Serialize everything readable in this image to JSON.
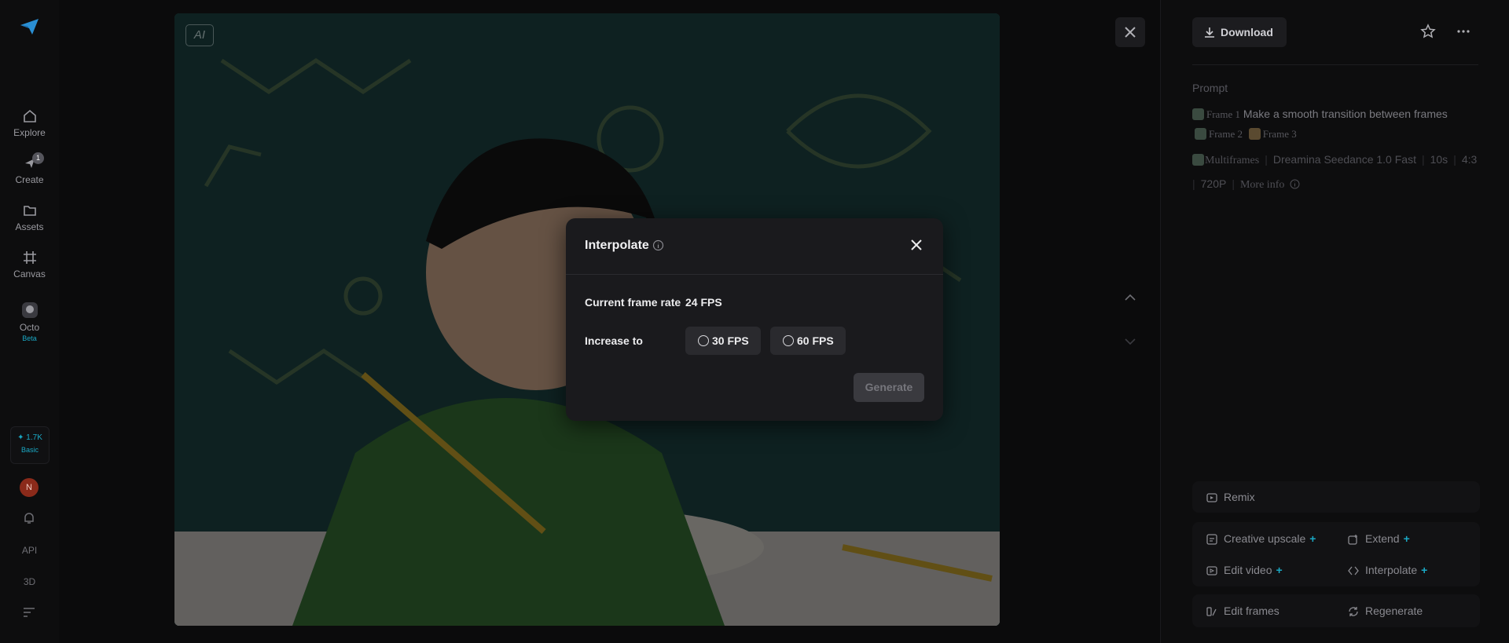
{
  "nav": {
    "items": [
      {
        "label": "Explore"
      },
      {
        "label": "Create",
        "badge": "1"
      },
      {
        "label": "Assets"
      },
      {
        "label": "Canvas"
      },
      {
        "label": "Octo",
        "tag": "Beta"
      }
    ],
    "credits": {
      "amount": "1.7K",
      "tier": "Basic"
    },
    "avatar_initial": "N",
    "api_label": "API",
    "three_d_label": "3D"
  },
  "image": {
    "ai_tag": "AI"
  },
  "panel": {
    "download_label": "Download",
    "prompt_label": "Prompt",
    "frame1": "Frame 1",
    "prompt_text": "Make a smooth transition between frames",
    "frame2": "Frame 2",
    "frame3": "Frame 3",
    "meta": {
      "mode": "Multiframes",
      "model": "Dreamina Seedance 1.0 Fast",
      "duration": "10s",
      "ratio": "4:3",
      "resolution": "720P",
      "more_info": "More info"
    },
    "actions": {
      "remix": "Remix",
      "creative_upscale": "Creative upscale",
      "extend": "Extend",
      "edit_video": "Edit video",
      "interpolate": "Interpolate",
      "edit_frames": "Edit frames",
      "regenerate": "Regenerate"
    }
  },
  "modal": {
    "title": "Interpolate",
    "current_label": "Current frame rate",
    "current_value": "24 FPS",
    "increase_label": "Increase to",
    "options": [
      "30 FPS",
      "60 FPS"
    ],
    "generate_label": "Generate"
  },
  "colors": {
    "accent": "#1aa8c4",
    "avatar": "#8b2a1a"
  }
}
